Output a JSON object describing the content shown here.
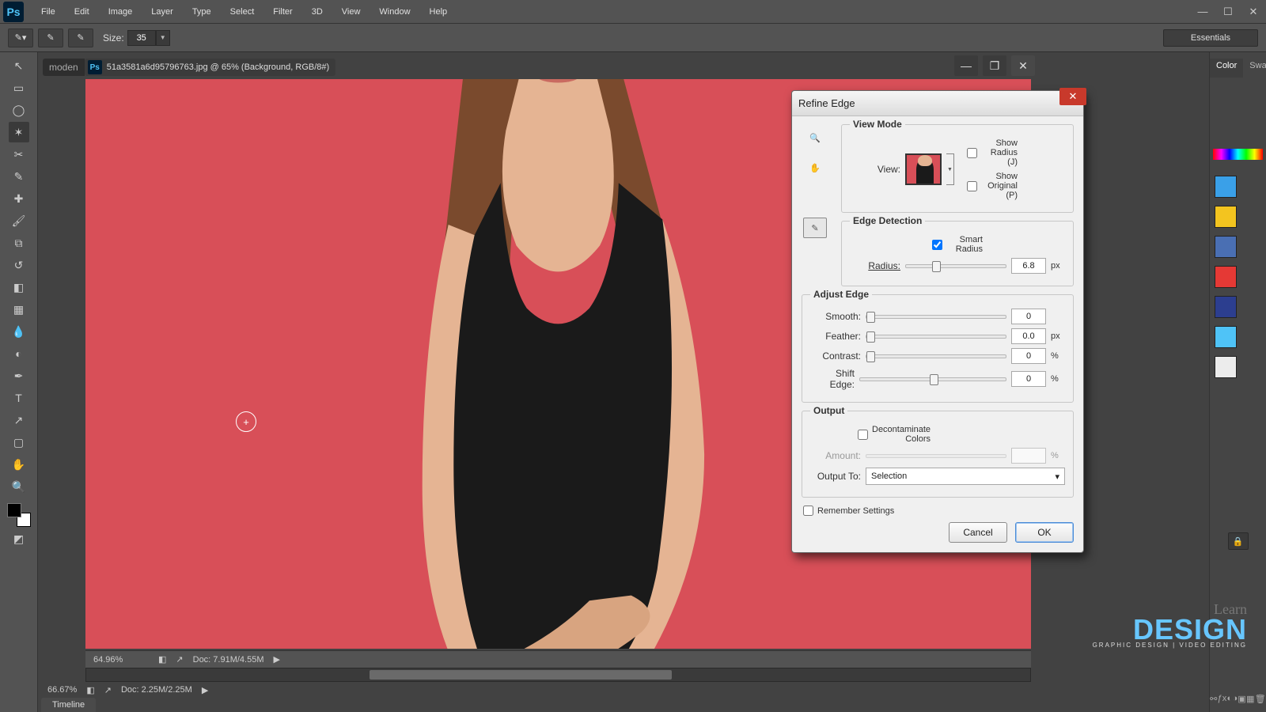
{
  "app": {
    "logo": "Ps"
  },
  "menu": [
    "File",
    "Edit",
    "Image",
    "Layer",
    "Type",
    "Select",
    "Filter",
    "3D",
    "View",
    "Window",
    "Help"
  ],
  "options": {
    "sizeLabel": "Size:",
    "size": "35"
  },
  "workspace": "Essentials",
  "doc": {
    "backTab": "moden",
    "title": "51a3581a6d95796763.jpg @ 65% (Background, RGB/8#)",
    "zoom1": "64.96%",
    "docinfo1": "Doc: 7.91M/4.55M",
    "zoom2": "66.67%",
    "docinfo2": "Doc: 2.25M/2.25M",
    "timeline": "Timeline"
  },
  "rightTabs": {
    "color": "Color",
    "swatches": "Swatches"
  },
  "dialog": {
    "title": "Refine Edge",
    "viewMode": {
      "legend": "View Mode",
      "viewLabel": "View:",
      "showRadius": "Show Radius (J)",
      "showOriginal": "Show Original (P)"
    },
    "edge": {
      "legend": "Edge Detection",
      "smartRadius": "Smart Radius",
      "radiusLabel": "Radius:",
      "radius": "6.8",
      "radiusUnit": "px"
    },
    "adjust": {
      "legend": "Adjust Edge",
      "smoothLabel": "Smooth:",
      "smooth": "0",
      "featherLabel": "Feather:",
      "feather": "0.0",
      "featherUnit": "px",
      "contrastLabel": "Contrast:",
      "contrast": "0",
      "contrastUnit": "%",
      "shiftLabel": "Shift Edge:",
      "shift": "0",
      "shiftUnit": "%"
    },
    "output": {
      "legend": "Output",
      "decon": "Decontaminate Colors",
      "amountLabel": "Amount:",
      "amount": "",
      "amountUnit": "%",
      "outputToLabel": "Output To:",
      "outputTo": "Selection"
    },
    "remember": "Remember Settings",
    "cancel": "Cancel",
    "ok": "OK"
  },
  "wm": {
    "learn": "Learn",
    "brand": "DESIGN",
    "tag": "GRAPHIC DESIGN | VIDEO EDITING"
  }
}
